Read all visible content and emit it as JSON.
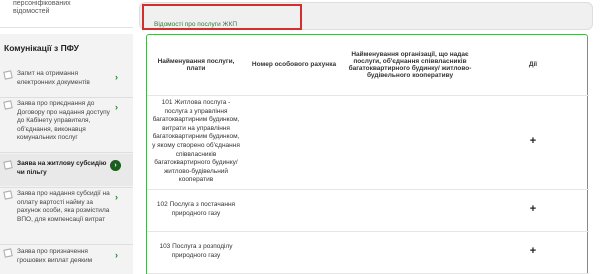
{
  "sidebar": {
    "top_lines": [
      "персоніфікованих",
      "відомостей"
    ],
    "section_title": "Комунікації з ПФУ",
    "items": [
      {
        "label": "Запит на отримання електронних документів"
      },
      {
        "label": "Заява про приєднання до Договору про надання доступу до Кабінету управителя, об'єднання, виконавця комунальних послуг"
      },
      {
        "label": "Заява на житлову субсидію чи пільгу",
        "active": true
      },
      {
        "label": "Заява про надання субсидії на оплату вартості найму за рахунок особи, яка розмістила ВПО, для компенсації витрат"
      },
      {
        "label": "Заява про призначення грошових виплат деяким"
      }
    ]
  },
  "tabs": {
    "active_label": "Відомості про послуги ЖКП"
  },
  "table": {
    "headers": [
      "Найменування послуги, плати",
      "Номер особового рахунка",
      "Найменування організації, що надає послуги, об'єднання співвласників багатоквартирного будинку/ житлово-будівельного кооперативу",
      "Дії"
    ],
    "rows": [
      {
        "service": "101 Житлова послуга - послуга з управління багатоквартирним будинком, витрати на управління багатоквартирним будинком, у якому створено об'єднання співвласників багатоквартирного будинку/ житлово-будівельний кооператив",
        "account": "",
        "org": "",
        "action": "+"
      },
      {
        "service": "102 Послуга з постачання природного газу",
        "account": "",
        "org": "",
        "action": "+"
      },
      {
        "service": "103 Послуга з розподілу природного газу",
        "account": "",
        "org": "",
        "action": "+"
      }
    ]
  },
  "icons": {
    "doc": "document-icon",
    "chevron": "chevron-right-icon",
    "plus": "plus-icon"
  },
  "colors": {
    "accent_green": "#2e7d32",
    "highlight_red": "#d32f2f",
    "border_green": "#4caf50"
  }
}
